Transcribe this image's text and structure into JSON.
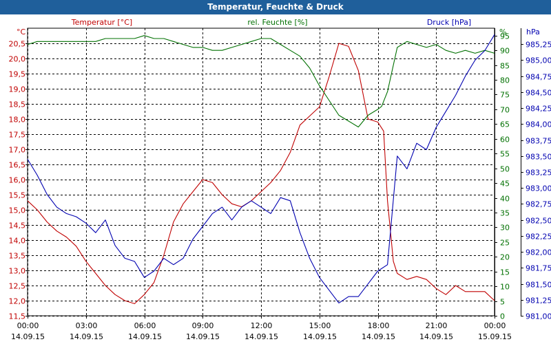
{
  "window": {
    "title": "Temperatur, Feuchte & Druck"
  },
  "colors": {
    "temperature": "#c00000",
    "humidity": "#007000",
    "pressure": "#0000b0",
    "titlebar": "#1f5f9b",
    "grid": "#000000"
  },
  "chart_data": {
    "type": "line",
    "title": "Temperatur, Feuchte & Druck",
    "grid": true,
    "axes": {
      "left": {
        "unit": "°C",
        "label": "Temperatur [°C]",
        "min": 11.5,
        "max": 21.0,
        "ticks": [
          "11,5",
          "12,0",
          "12,5",
          "13,0",
          "13,5",
          "14,0",
          "14,5",
          "15,0",
          "15,5",
          "16,0",
          "16,5",
          "17,0",
          "17,5",
          "18,0",
          "18,5",
          "19,0",
          "19,5",
          "20,0",
          "20,5"
        ]
      },
      "middle": {
        "unit": "%",
        "label": "rel. Feuchte [%]",
        "min": 0,
        "max": 97.5,
        "ticks": [
          "0",
          "5",
          "10",
          "15",
          "20",
          "25",
          "30",
          "35",
          "40",
          "45",
          "50",
          "55",
          "60",
          "65",
          "70",
          "75",
          "80",
          "85",
          "90",
          "95"
        ]
      },
      "right": {
        "unit": "hPa",
        "label": "Druck [hPa]",
        "min": 981.0,
        "max": 985.5,
        "ticks": [
          "981,00",
          "981,25",
          "981,50",
          "981,75",
          "982,00",
          "982,25",
          "982,50",
          "982,75",
          "983,00",
          "983,25",
          "983,50",
          "983,75",
          "984,00",
          "984,25",
          "984,50",
          "984,75",
          "985,00",
          "985,25"
        ]
      },
      "x": {
        "min_hours": 0,
        "max_hours": 24,
        "ticks": [
          {
            "time": "00:00",
            "date": "14.09.15"
          },
          {
            "time": "03:00",
            "date": "14.09.15"
          },
          {
            "time": "06:00",
            "date": "14.09.15"
          },
          {
            "time": "09:00",
            "date": "14.09.15"
          },
          {
            "time": "12:00",
            "date": "14.09.15"
          },
          {
            "time": "15:00",
            "date": "14.09.15"
          },
          {
            "time": "18:00",
            "date": "14.09.15"
          },
          {
            "time": "21:00",
            "date": "14.09.15"
          },
          {
            "time": "00:00",
            "date": "15.09.15"
          }
        ]
      }
    },
    "series": [
      {
        "name": "Temperatur [°C]",
        "axis": "left",
        "x": [
          0,
          0.5,
          1,
          1.5,
          2,
          2.5,
          3,
          3.5,
          4,
          4.5,
          5,
          5.5,
          6,
          6.5,
          7,
          7.5,
          8,
          8.5,
          9,
          9.5,
          10,
          10.5,
          11,
          11.5,
          12,
          12.5,
          13,
          13.5,
          14,
          14.5,
          15,
          15.5,
          16,
          16.5,
          17,
          17.5,
          18,
          18.3,
          18.5,
          18.8,
          19,
          19.5,
          20,
          20.5,
          21,
          21.5,
          22,
          22.5,
          23,
          23.5,
          24
        ],
        "values": [
          15.3,
          15.0,
          14.6,
          14.3,
          14.1,
          13.8,
          13.3,
          12.9,
          12.5,
          12.2,
          12.0,
          11.9,
          12.2,
          12.6,
          13.5,
          14.6,
          15.2,
          15.6,
          16.0,
          15.9,
          15.5,
          15.2,
          15.1,
          15.3,
          15.6,
          15.9,
          16.3,
          16.9,
          17.8,
          18.1,
          18.4,
          19.4,
          20.5,
          20.4,
          19.6,
          18.0,
          17.9,
          17.6,
          15.3,
          13.3,
          12.9,
          12.7,
          12.8,
          12.7,
          12.4,
          12.2,
          12.5,
          12.3,
          12.3,
          12.3,
          12.0
        ]
      },
      {
        "name": "rel. Feuchte [%]",
        "axis": "middle",
        "x": [
          0,
          0.5,
          1,
          1.5,
          2,
          2.5,
          3,
          3.5,
          4,
          4.5,
          5,
          5.5,
          6,
          6.5,
          7,
          7.5,
          8,
          8.5,
          9,
          9.5,
          10,
          10.5,
          11,
          11.5,
          12,
          12.5,
          13,
          13.5,
          14,
          14.5,
          15,
          15.5,
          16,
          16.5,
          17,
          17.5,
          18,
          18.2,
          18.5,
          19,
          19.5,
          20,
          20.5,
          21,
          21.5,
          22,
          22.5,
          23,
          23.5,
          24
        ],
        "values": [
          92,
          93,
          93,
          93,
          93,
          93,
          93,
          93,
          94,
          94,
          94,
          94,
          95,
          94,
          94,
          93,
          92,
          91,
          91,
          90,
          90,
          91,
          92,
          93,
          94,
          94,
          92,
          90,
          88,
          84,
          78,
          73,
          68,
          66,
          64,
          68,
          70,
          71,
          76,
          91,
          93,
          92,
          91,
          92,
          90,
          89,
          90,
          89,
          90,
          89
        ]
      },
      {
        "name": "Druck [hPa]",
        "axis": "right",
        "x": [
          0,
          0.5,
          1,
          1.5,
          2,
          2.5,
          3,
          3.5,
          4,
          4.5,
          5,
          5.5,
          6,
          6.5,
          7,
          7.5,
          8,
          8.5,
          9,
          9.5,
          10,
          10.5,
          11,
          11.5,
          12,
          12.5,
          13,
          13.5,
          14,
          14.5,
          15,
          15.5,
          16,
          16.5,
          17,
          17.5,
          18,
          18.5,
          19,
          19.5,
          20,
          20.5,
          21,
          21.5,
          22,
          22.5,
          23,
          23.5,
          24
        ],
        "values": [
          983.45,
          983.2,
          982.9,
          982.7,
          982.6,
          982.55,
          982.45,
          982.3,
          982.5,
          982.1,
          981.9,
          981.85,
          981.6,
          981.7,
          981.9,
          981.8,
          981.9,
          982.2,
          982.4,
          982.6,
          982.7,
          982.5,
          982.7,
          982.8,
          982.7,
          982.6,
          982.85,
          982.8,
          982.3,
          981.9,
          981.6,
          981.4,
          981.2,
          981.3,
          981.3,
          981.5,
          981.7,
          981.8,
          983.5,
          983.3,
          983.7,
          983.6,
          983.95,
          984.2,
          984.45,
          984.75,
          985.0,
          985.15,
          985.4
        ]
      }
    ]
  }
}
